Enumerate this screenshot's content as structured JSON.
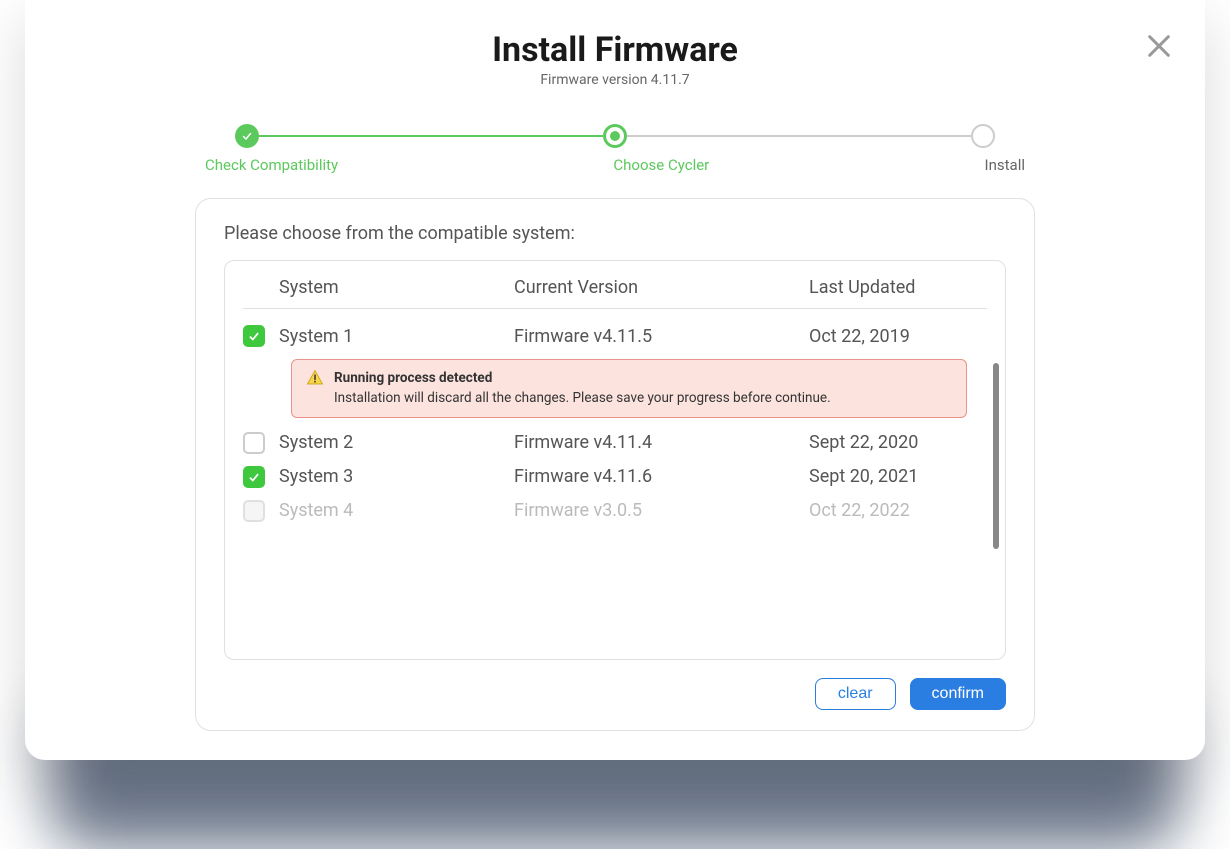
{
  "header": {
    "title": "Install Firmware",
    "subtitle": "Firmware version 4.11.7"
  },
  "stepper": {
    "steps": [
      {
        "label": "Check Compatibility",
        "state": "completed"
      },
      {
        "label": "Choose Cycler",
        "state": "active"
      },
      {
        "label": "Install",
        "state": "pending"
      }
    ]
  },
  "content": {
    "prompt": "Please choose from the compatible system:",
    "columns": {
      "system": "System",
      "version": "Current Version",
      "updated": "Last Updated"
    },
    "rows": [
      {
        "system": "System 1",
        "version": "Firmware v4.11.5",
        "updated": "Oct 22, 2019",
        "checked": true,
        "disabled": false,
        "warning": true
      },
      {
        "system": "System 2",
        "version": "Firmware v4.11.4",
        "updated": "Sept 22, 2020",
        "checked": false,
        "disabled": false,
        "warning": false
      },
      {
        "system": "System 3",
        "version": "Firmware v4.11.6",
        "updated": "Sept 20, 2021",
        "checked": true,
        "disabled": false,
        "warning": false
      },
      {
        "system": "System 4",
        "version": "Firmware v3.0.5",
        "updated": "Oct 22, 2022",
        "checked": false,
        "disabled": true,
        "warning": false
      }
    ],
    "warning": {
      "title": "Running process detected",
      "body": "Installation will discard all the changes. Please save your progress before continue."
    }
  },
  "actions": {
    "clear": "clear",
    "confirm": "confirm"
  }
}
